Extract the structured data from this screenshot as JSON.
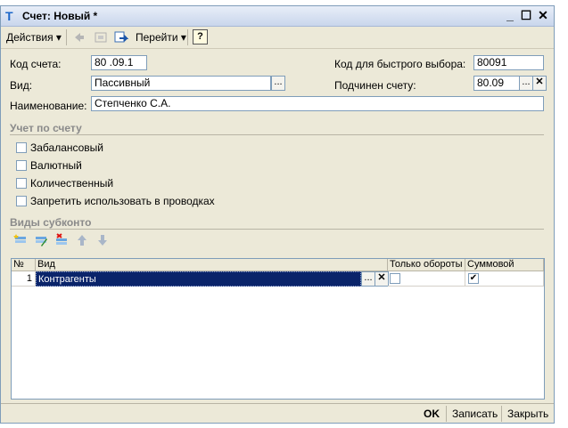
{
  "window": {
    "title": "Счет: Новый *",
    "minimize": "_",
    "maximize": "☐",
    "close": "✕"
  },
  "toolbar": {
    "actions": "Действия",
    "goto": "Перейти",
    "help": "?"
  },
  "form": {
    "code_label": "Код счета:",
    "code_value": "80 .09.1",
    "quick_code_label": "Код для быстрого выбора:",
    "quick_code_value": "80091",
    "type_label": "Вид:",
    "type_value": "Пассивный",
    "parent_label": "Подчинен счету:",
    "parent_value": "80.09",
    "name_label": "Наименование:",
    "name_value": "Степченко С.А."
  },
  "accounting": {
    "title": "Учет по счету",
    "options": [
      {
        "label": "Забалансовый",
        "checked": false
      },
      {
        "label": "Валютный",
        "checked": false
      },
      {
        "label": "Количественный",
        "checked": false
      },
      {
        "label": "Запретить использовать в проводках",
        "checked": false
      }
    ]
  },
  "subconto": {
    "title": "Виды субконто",
    "columns": [
      "№",
      "Вид",
      "Только обороты",
      "Суммовой"
    ],
    "rows": [
      {
        "num": "1",
        "kind": "Контрагенты",
        "turnover_only": false,
        "sum": true
      }
    ]
  },
  "footer": {
    "ok": "OK",
    "save": "Записать",
    "close": "Закрыть"
  },
  "colors": {
    "title_icon": "#1b66c9",
    "selection": "#0a246a",
    "window_bg": "#ece9d8",
    "border": "#7f9db9"
  }
}
